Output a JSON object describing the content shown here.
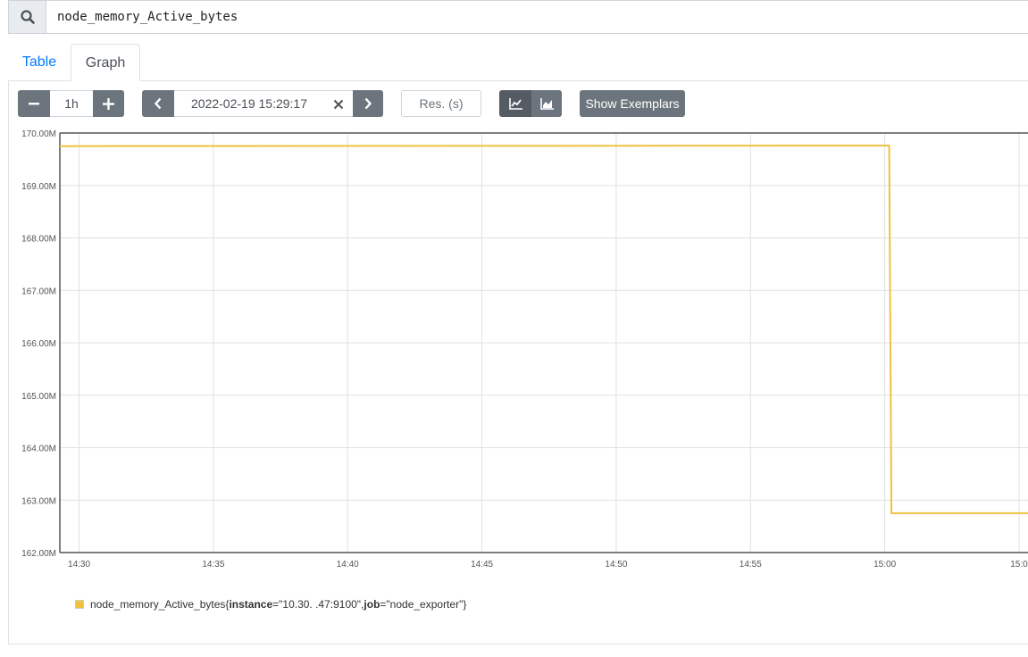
{
  "query": {
    "expression": "node_memory_Active_bytes",
    "search_icon": "search-icon"
  },
  "tabs": [
    {
      "label": "Table",
      "active": false
    },
    {
      "label": "Graph",
      "active": true
    }
  ],
  "controls": {
    "range": "1h",
    "minus_icon": "minus-icon",
    "plus_icon": "plus-icon",
    "end_time": "2022-02-19 15:29:17",
    "clear_icon": "close-icon",
    "prev_icon": "chevron-left-icon",
    "next_icon": "chevron-right-icon",
    "resolution_placeholder": "Res. (s)",
    "line_mode_icon": "line-chart-icon",
    "stacked_mode_icon": "area-chart-icon",
    "show_exemplars_label": "Show Exemplars"
  },
  "colors": {
    "series": "#edc240",
    "button": "#6c757d",
    "button_active": "#545b62",
    "tab_link": "#007bff"
  },
  "legend": {
    "metric": "node_memory_Active_bytes",
    "open_brace": "{",
    "label1_key": "instance",
    "label1_value": "=\"10.30.    .47:9100\", ",
    "label2_key": "job",
    "label2_value": "=\"node_exporter\"}"
  },
  "chart_data": {
    "type": "line",
    "title": "",
    "xlabel": "",
    "ylabel": "",
    "ylim": [
      162000000,
      170000000
    ],
    "y_ticks": [
      "162.00M",
      "163.00M",
      "164.00M",
      "165.00M",
      "166.00M",
      "167.00M",
      "168.00M",
      "169.00M",
      "170.00M"
    ],
    "x_range": [
      "14:29:17",
      "15:05:20"
    ],
    "x_ticks": [
      "14:30",
      "14:35",
      "14:40",
      "14:45",
      "14:50",
      "14:55",
      "15:00",
      "15:0"
    ],
    "grid": true,
    "series": [
      {
        "name": "node_memory_Active_bytes{instance=\"10.30.    .47:9100\", job=\"node_exporter\"}",
        "x": [
          "14:29:17",
          "15:00:10",
          "15:00:15",
          "15:05:20"
        ],
        "values": [
          169750000,
          169760000,
          162750000,
          162750000
        ]
      }
    ]
  }
}
